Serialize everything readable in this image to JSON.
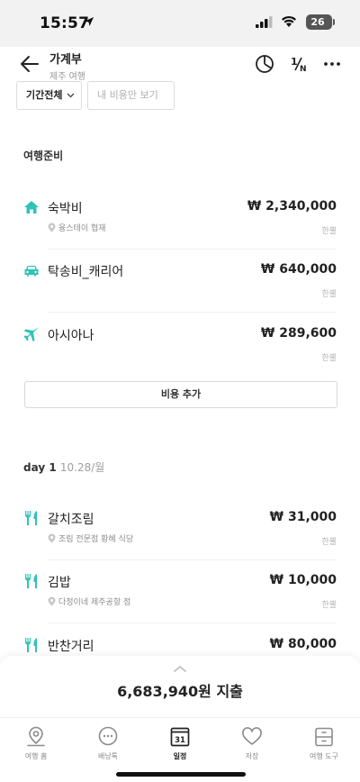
{
  "status_bar": {
    "time": "15:57",
    "battery": "26"
  },
  "header": {
    "title": "가계부",
    "subtitle": "제주 여행",
    "split_icon_label": "1/N"
  },
  "filters": {
    "period": "기간전체",
    "mine_only": "내 비용만 보기"
  },
  "prep": {
    "title": "여행준비",
    "items": [
      {
        "icon": "home-icon",
        "name": "숙박비",
        "amount": "₩ 2,340,000",
        "place": "융스테이 협재",
        "settle": "한뿔"
      },
      {
        "icon": "car-icon",
        "name": "탁송비_캐리어",
        "amount": "₩ 640,000",
        "place": "",
        "settle": "한뿔"
      },
      {
        "icon": "airplane-icon",
        "name": "아시아나",
        "amount": "₩ 289,600",
        "place": "",
        "settle": "한뿔"
      }
    ],
    "add_button": "비용 추가"
  },
  "day1": {
    "day": "day 1",
    "date": "10.28/월",
    "items": [
      {
        "icon": "fork-knife-icon",
        "name": "갈치조림",
        "amount": "₩ 31,000",
        "place": "조림 전문점 황혜 식당",
        "settle": "한뿔"
      },
      {
        "icon": "fork-knife-icon",
        "name": "김밥",
        "amount": "₩ 10,000",
        "place": "다정이네 제주공항 점",
        "settle": "한뿔"
      },
      {
        "icon": "fork-knife-icon",
        "name": "반찬거리",
        "amount": "₩ 80,000",
        "place": "",
        "settle": ""
      }
    ]
  },
  "summary": {
    "total": "6,683,940원 지출"
  },
  "tabs": [
    {
      "label": "여행 홈",
      "icon": "map-pin-icon"
    },
    {
      "label": "배낭톡",
      "icon": "chat-icon"
    },
    {
      "label": "일정",
      "icon": "calendar-icon",
      "day": "31"
    },
    {
      "label": "저장",
      "icon": "heart-icon"
    },
    {
      "label": "여행 도구",
      "icon": "toolbox-icon"
    }
  ],
  "colors": {
    "accent": "#2ec4b6",
    "text": "#222222",
    "muted": "#999999"
  }
}
